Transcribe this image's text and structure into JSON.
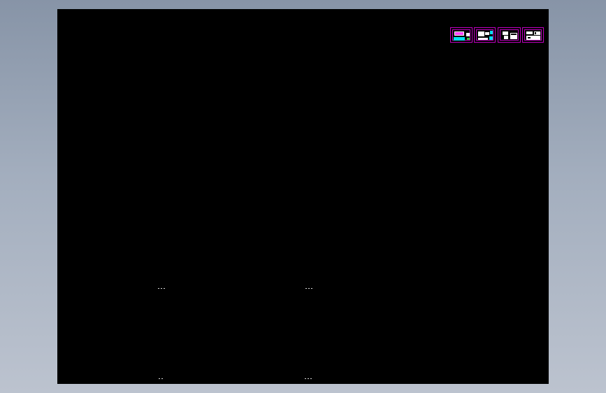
{
  "app": {
    "view": "cad-model-space"
  },
  "colors": {
    "background_top": "#8794a7",
    "background_bottom": "#bcc3cf",
    "model_space": "#000000",
    "sheet_border": "#c000c0",
    "accent_cyan": "#00e0f0",
    "accent_green": "#30d030"
  },
  "sheets": [
    {
      "name": "drawing-sheet-1",
      "icon": "colored-drawing-thumbnail"
    },
    {
      "name": "drawing-sheet-2",
      "icon": "colored-drawing-thumbnail"
    },
    {
      "name": "drawing-sheet-3",
      "icon": "monochrome-drawing-thumbnail"
    },
    {
      "name": "drawing-sheet-4",
      "icon": "monochrome-drawing-thumbnail"
    }
  ]
}
